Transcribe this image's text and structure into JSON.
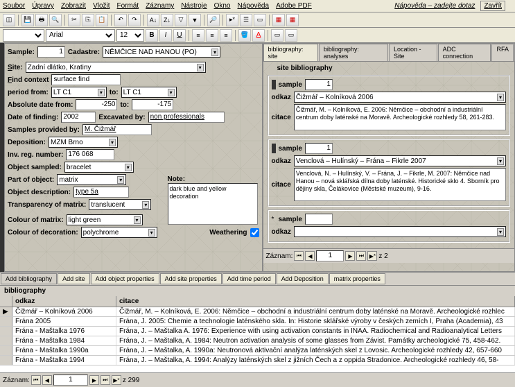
{
  "menu": {
    "items": [
      "Soubor",
      "Úpravy",
      "Zobrazit",
      "Vložit",
      "Formát",
      "Záznamy",
      "Nástroje",
      "Okno",
      "Nápověda",
      "Adobe PDF"
    ],
    "help": "Nápověda – zadejte dotaz",
    "close": "Zavřít"
  },
  "toolbar2": {
    "font": "Arial",
    "size": "12"
  },
  "left": {
    "sample_lbl": "Sample:",
    "sample_val": "1",
    "cadastre_lbl": "Cadastre:",
    "cadastre_val": "NĚMČICE NAD HANOU (PO)",
    "site_lbl": "Site:",
    "site_val": "Zadní dlátko, Kratiny",
    "findctx_lbl": "Find context:",
    "findctx_val": "surface find",
    "period_lbl": "period from:",
    "period_from": "LT C1",
    "to_lbl": "to:",
    "period_to": "LT C1",
    "absdate_lbl": "Absolute date from:",
    "absdate_from": "-250",
    "absdate_to": "-175",
    "datefind_lbl": "Date of finding:",
    "datefind_val": "2002",
    "excav_lbl": "Excavated by:",
    "excav_val": "non professionals",
    "samples_lbl": "Samples provided by:",
    "samples_val": "M. Čižmář",
    "depo_lbl": "Deposition:",
    "depo_val": "MZM Brno",
    "note_lbl": "Note:",
    "note_val": "dark blue and yellow decoration",
    "invreg_lbl": "Inv. reg. number:",
    "invreg_val": "176 068",
    "objsamp_lbl": "Object sampled:",
    "objsamp_val": "bracelet",
    "partobj_lbl": "Part of object:",
    "partobj_val": "matrix",
    "objdesc_lbl": "Object description:",
    "objdesc_val": "type 5a",
    "transp_lbl": "Transparency of matrix:",
    "transp_val": "translucent",
    "colmat_lbl": "Colour of matrix:",
    "colmat_val": "light green",
    "coldec_lbl": "Colour of decoration:",
    "coldec_val": "polychrome",
    "weather_lbl": "Weathering"
  },
  "righttabs": [
    "bibliography: site",
    "bibliography: analyses",
    "Location - Site",
    "ADC connection",
    "RFA"
  ],
  "rightbox_title": "site bibliography",
  "bib": [
    {
      "sample": "1",
      "odkaz": "Čižmář – Kolníková 2006",
      "citace": "Čižmář, M. – Kolníková, E. 2006: Němčice – obchodní a industriální centrum doby laténské na Moravě. Archeologické rozhledy 58, 261-283."
    },
    {
      "sample": "1",
      "odkaz": "Venclová – Hulínský – Frána – Fikrle 2007",
      "citace": "Venclová, N. – Hulínský, V. – Frána, J. – Fikrle, M. 2007: Němčice nad Hanou – nová sklářská dílna doby laténské. Historické sklo 4. Sborník pro dějiny skla, Čelákovice (Městské muzeum), 9-16."
    },
    {
      "sample": "",
      "odkaz": "",
      "citace": ""
    }
  ],
  "lbls": {
    "sample": "sample",
    "odkaz": "odkaz",
    "citace": "citace",
    "zaznam": "Záznam:",
    "zcount": "z 2"
  },
  "btabs": [
    "Add bibliography",
    "Add site",
    "Add object properties",
    "Add site properties",
    "Add time period",
    "Add Deposition",
    "matrix properties"
  ],
  "grid": {
    "h1": "odkaz",
    "h2": "citace",
    "rows": [
      {
        "o": "Čižmář – Kolníková 2006",
        "c": "Čižmář, M. – Kolníková, E. 2006: Němčice – obchodní a industriální centrum doby laténské na Moravě. Archeologické rozhlec"
      },
      {
        "o": "Frána 2005",
        "c": "Frána, J. 2005: Chemie a technologie laténského skla. In: Historie sklářské výroby v českých zemích I, Praha (Academia), 43"
      },
      {
        "o": "Frána - Maštalka 1976",
        "c": "Frána, J. – Maštalka A. 1976: Experience with using activation constants in INAA. Radiochemical and Radioanalytical Letters"
      },
      {
        "o": "Frána - Maštalka 1984",
        "c": "Frána, J. – Maštalka, A. 1984: Neutron activation analysis of some glasses from Závist. Památky archeologické 75, 458-462."
      },
      {
        "o": "Frána - Maštalka 1990a",
        "c": "Frána, J. – Maštalka, A. 1990a: Neutronová aktivační analýza laténských skel z Lovosic. Archeologické rozhledy 42, 657-660"
      },
      {
        "o": "Frána - Maštalka 1994",
        "c": "Frána, J. – Maštalka, A. 1994: Analýzy laténských skel z jižních Čech a z oppida Stradonice. Archeologické rozhledy 46, 58-"
      }
    ]
  },
  "status": {
    "zaznam": "Záznam:",
    "cur": "1",
    "total": "z 299"
  },
  "biblbl": "bibliography"
}
